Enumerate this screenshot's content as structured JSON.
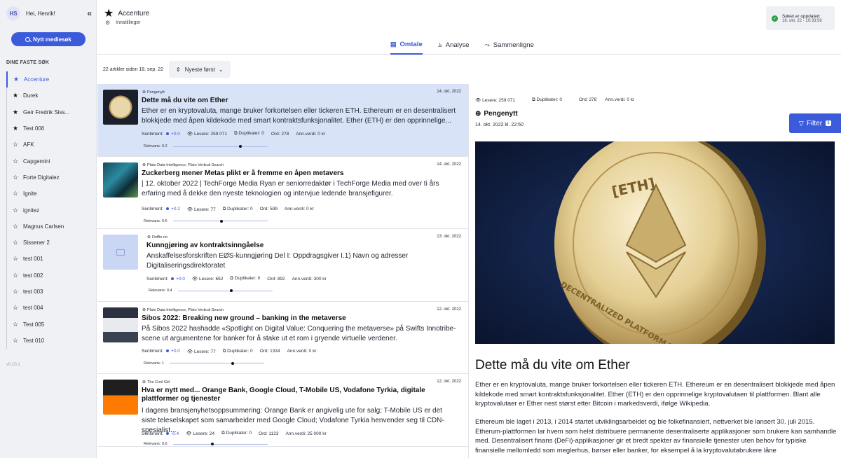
{
  "user": {
    "initials": "HS",
    "greeting": "Hei, Henrik!"
  },
  "sidebar": {
    "collapse_icon": "«",
    "new_search_label": "Nytt mediesøk",
    "section_title": "DINE FASTE SØK",
    "items": [
      {
        "label": "Accenture",
        "starred": true,
        "active": true
      },
      {
        "label": "Durek",
        "starred": true
      },
      {
        "label": "Geir Fredrik Siss...",
        "starred": true
      },
      {
        "label": "Test 006",
        "starred": true
      },
      {
        "label": "AFK",
        "starred": false
      },
      {
        "label": "Capgemini",
        "starred": false
      },
      {
        "label": "Forte Digitalez",
        "starred": false
      },
      {
        "label": "Ignite",
        "starred": false
      },
      {
        "label": "ignitez",
        "starred": false
      },
      {
        "label": "Magnus Carlsen",
        "starred": false
      },
      {
        "label": "Sissener 2",
        "starred": false
      },
      {
        "label": "test 001",
        "starred": false
      },
      {
        "label": "test 002",
        "starred": false
      },
      {
        "label": "test 003",
        "starred": false
      },
      {
        "label": "test 004",
        "starred": false
      },
      {
        "label": "Test 005",
        "starred": false
      },
      {
        "label": "Test 010",
        "starred": false
      }
    ],
    "version": "v0.10.1"
  },
  "header": {
    "title": "Accenture",
    "settings_label": "Innstillinger",
    "status_title": "Søket er oppdatert",
    "status_time": "18. okt. 22 - 10:33:56",
    "tabs": [
      {
        "label": "Omtale",
        "active": true
      },
      {
        "label": "Analyse",
        "active": false
      },
      {
        "label": "Sammenligne",
        "active": false
      }
    ]
  },
  "list": {
    "count_text": "22 artikler siden 18. sep. 22",
    "sort_label": "Nyeste først",
    "articles": [
      {
        "source": "Pengenytt",
        "date": "14. okt. 2022",
        "title": "Dette må du vite om Ether",
        "snippet": "Ether er en kryptovaluta, mange bruker forkortelsen eller tickeren ETH. Ethereum er en desentralisert blokkjede med åpen kildekode med smart kontraktsfunksjonalitet. Ether (ETH) er den opprinnelige...",
        "sentiment": "+0.0",
        "readers": "Lesere: 259 071",
        "duplicates": "Duplikater: 0",
        "words": "Ord: 278",
        "value": "Ann.verdi: 0 kr",
        "relevance": "Relevans: 0.2",
        "relevance_level": 0.7
      },
      {
        "source": "Plato Data Intelligence, Plato Vertical Search",
        "date": "14. okt. 2022",
        "title": "Zuckerberg mener Metas plikt er å fremme en åpen metavers",
        "snippet": "| 12. oktober 2022 | TechForge Media Ryan er seniorredaktør i TechForge Media med over ti års erfaring med å dekke den nyeste teknologien og intervjue ledende bransjefigurer.",
        "sentiment": "+0.2",
        "readers": "Lesere: 77",
        "duplicates": "Duplikater: 0",
        "words": "Ord: 599",
        "value": "Ann.verdi: 0 kr",
        "relevance": "Relevans: 0.6",
        "relevance_level": 0.5
      },
      {
        "source": "Doffin.no",
        "date": "13. okt. 2022",
        "title": "Kunngjøring av kontraktsinngåelse",
        "snippet": "Anskaffelsesforskriften EØS-kunngjøring Del I: Oppdragsgiver I.1) Navn og adresser Digitaliseringsdirektoratet",
        "sentiment": "+0.0",
        "readers": "Lesere: 652",
        "duplicates": "Duplikater: 0",
        "words": "Ord: 892",
        "value": "Ann.verdi: 300 kr",
        "relevance": "Relevans: 0.4",
        "relevance_level": 0.55
      },
      {
        "source": "Plato Data Intelligence, Plato Vertical Search",
        "date": "12. okt. 2022",
        "title": "Sibos 2022: Breaking new ground – banking in the metaverse",
        "snippet": "På Sibos 2022 hashadde «Spotlight on Digital Value: Conquering the metaverse» på Swifts Innotribe-scene ut argumentene for banker for å stake ut et rom i gryende virtuelle verdener.",
        "sentiment": "+0.0",
        "readers": "Lesere: 77",
        "duplicates": "Duplikater: 0",
        "words": "Ord: 1334",
        "value": "Ann.verdi: 0 kr",
        "relevance": "Relevans: 1",
        "relevance_level": 0.65
      },
      {
        "source": "The Cool Girl",
        "date": "12. okt. 2022",
        "title": "Hva er nytt med... Orange Bank, Google Cloud, T-Mobile US, Vodafone Tyrkia, digitale plattformer og tjenester",
        "snippet": "I dagens bransjenyhetsoppsummering: Orange Bank er angivelig ute for salg; T-Mobile US er det siste teleselskapet som samarbeider med Google Cloud; Vodafone Tyrkia henvender seg til CDN-spesialist...",
        "sentiment": "-0.4",
        "readers": "Lesere: 24",
        "duplicates": "Duplikater: 0",
        "words": "Ord: 1123",
        "value": "Ann.verdi: 25 000 kr",
        "relevance": "Relevans: 0.6",
        "relevance_level": 0.4
      }
    ]
  },
  "detail": {
    "readers": "Lesere: 259 071",
    "duplicates": "Duplikater: 0",
    "words": "Ord: 278",
    "value": "Ann.verdi: 0 kr",
    "source": "Pengenytt",
    "datetime": "14. okt. 2022 kl. 22:50",
    "filter_label": "Filter",
    "filter_count": "1",
    "hero_text": "DECENTRALIZED PLATFORM THAT RUNS SMART CONTRACTS",
    "hero_symbol": "[ETH]",
    "title": "Dette må du vite om Ether",
    "paragraphs": [
      "Ether er en kryptovaluta, mange bruker forkortelsen eller tickeren ETH. Ethereum er en desentralisert blokkjede med åpen kildekode med smart kontraktsfunksjonalitet. Ether (ETH) er den opprinnelige kryptovalutaen til plattformen. Blant alle kryptovalutaer er Ether nest størst etter Bitcoin i markedsverdi, ifølge Wikipedia.",
      "Ethereum ble laget i 2013, i 2014 startet utviklingsarbeidet og ble folkefinansiert, nettverket ble lansert 30. juli 2015. Etherum-plattformen lar hvem som helst distribuere permanente desentraliserte applikasjoner som brukere kan samhandle med. Desentralisert finans (DeFi)-applikasjoner gir et bredt spekter av finansielle tjenester uten behov for typiske finansielle mellomledd som meglerhus, børser eller banker, for eksempel å la kryptovalutabrukere låne"
    ]
  },
  "colors": {
    "accent": "#3b5bdb",
    "selected_row": "#d9e3f7",
    "sidebar_bg": "#f0f1f4",
    "success": "#2f9e44"
  }
}
